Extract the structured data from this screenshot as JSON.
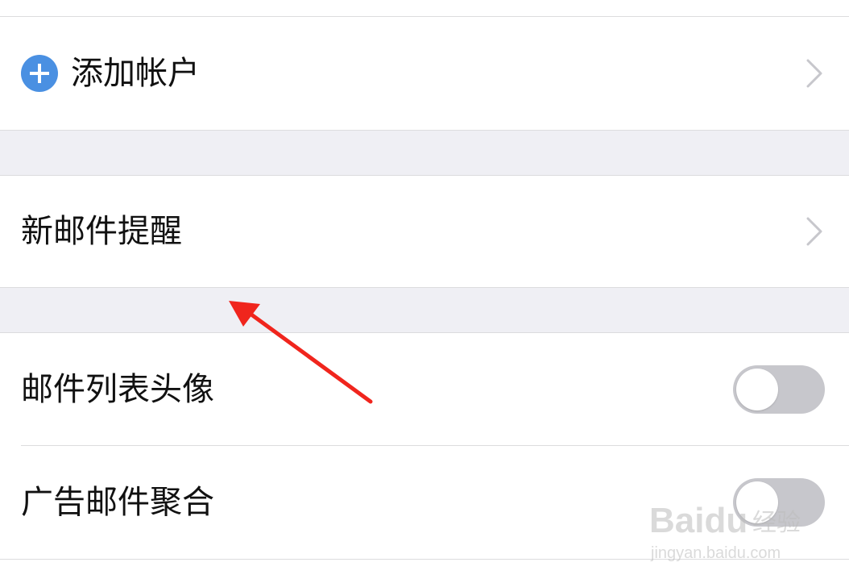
{
  "rows": {
    "add_account": {
      "label": "添加帐户",
      "icon": "plus-circle-icon",
      "action_icon": "chevron-right-icon"
    },
    "new_mail_alert": {
      "label": "新邮件提醒",
      "action_icon": "chevron-right-icon"
    },
    "list_avatar": {
      "label": "邮件列表头像",
      "toggle": "off"
    },
    "ad_mail_aggregate": {
      "label": "广告邮件聚合",
      "toggle": "off"
    }
  },
  "annotation": {
    "type": "red-arrow",
    "color": "#f0251d"
  },
  "colors": {
    "accent_blue": "#4a90e2",
    "toggle_off": "#c7c7cc",
    "section_gap": "#efeff4",
    "text": "#111111",
    "divider": "#dcdcde"
  },
  "watermark": {
    "brand": "Baidu",
    "brand_cn": "经验",
    "url": "jingyan.baidu.com"
  }
}
